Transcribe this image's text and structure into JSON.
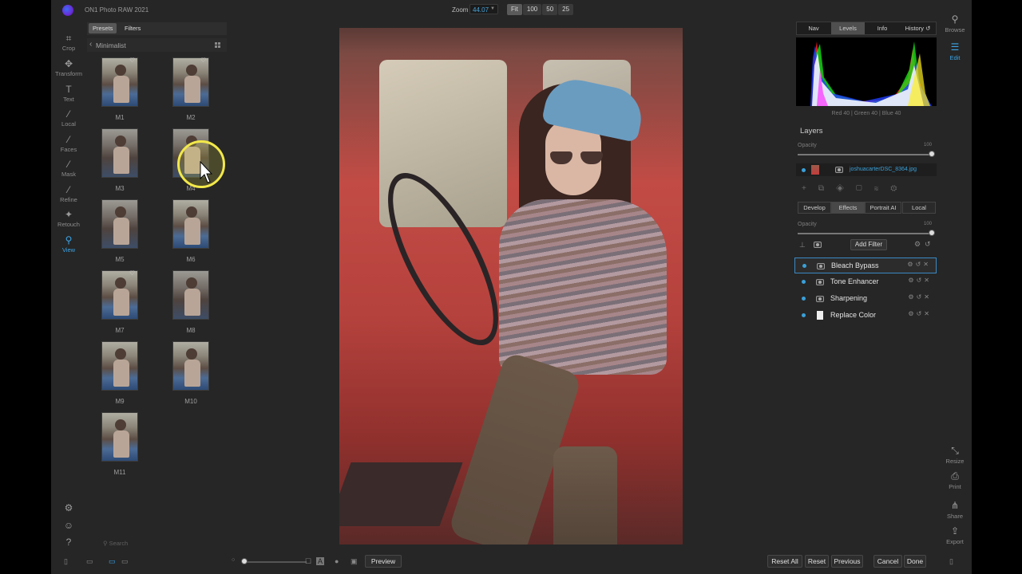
{
  "app": {
    "title": "ON1 Photo RAW 2021"
  },
  "zoom": {
    "label": "Zoom",
    "value": "44.07",
    "buttons": [
      "Fit",
      "100",
      "50",
      "25"
    ],
    "active": "Fit"
  },
  "left_tools": [
    {
      "label": "Crop",
      "icon": "crop-icon"
    },
    {
      "label": "Transform",
      "icon": "transform-icon"
    },
    {
      "label": "Text",
      "icon": "text-icon"
    },
    {
      "label": "Local",
      "icon": "brush-icon"
    },
    {
      "label": "Faces",
      "icon": "faces-icon"
    },
    {
      "label": "Mask",
      "icon": "mask-brush-icon"
    },
    {
      "label": "Refine",
      "icon": "refine-icon"
    },
    {
      "label": "Retouch",
      "icon": "retouch-icon"
    },
    {
      "label": "View",
      "icon": "zoom-icon",
      "active": true
    }
  ],
  "presets_panel": {
    "tabs": [
      "Presets",
      "Filters"
    ],
    "active_tab": "Presets",
    "category": "Minimalist",
    "items": [
      "M1",
      "M2",
      "M3",
      "M4",
      "M5",
      "M6",
      "M7",
      "M8",
      "M9",
      "M10",
      "M11"
    ],
    "favorites": [
      "M1",
      "M2",
      "M7"
    ],
    "search_placeholder": "Search"
  },
  "right_tabs": {
    "items": [
      "Nav",
      "Levels",
      "Info",
      "History"
    ],
    "active": "Levels"
  },
  "histogram": {
    "readout": "Red  40  | Green  40  | Blue  40"
  },
  "layers": {
    "title": "Layers",
    "opacity_label": "Opacity",
    "opacity_value": "100",
    "opacity_fraction": 1.0,
    "layer_name": "joshuacarterDSC_8364.jpg"
  },
  "module_tabs": {
    "items": [
      "Develop",
      "Effects",
      "Portrait AI",
      "Local"
    ],
    "active": "Effects"
  },
  "effects": {
    "opacity_label": "Opacity",
    "opacity_value": "100",
    "opacity_fraction": 1.0,
    "add_filter_label": "Add Filter",
    "filters": [
      "Bleach Bypass",
      "Tone Enhancer",
      "Sharpening",
      "Replace Color"
    ],
    "selected": "Bleach Bypass"
  },
  "right_tools_top": [
    {
      "label": "Browse",
      "icon": "browse-icon"
    },
    {
      "label": "Edit",
      "icon": "sliders-icon",
      "active": true
    }
  ],
  "right_tools_bottom": [
    {
      "label": "Resize",
      "icon": "resize-icon"
    },
    {
      "label": "Print",
      "icon": "print-icon"
    },
    {
      "label": "Share",
      "icon": "share-icon"
    },
    {
      "label": "Export",
      "icon": "export-icon"
    }
  ],
  "bottom_bar": {
    "preview_label": "Preview",
    "buttons": [
      "Reset All",
      "Reset",
      "Previous",
      "Cancel",
      "Done"
    ]
  },
  "colors": {
    "accent": "#3ba4e6",
    "panel": "#262626",
    "cursor_highlight": "#f2e84a"
  }
}
